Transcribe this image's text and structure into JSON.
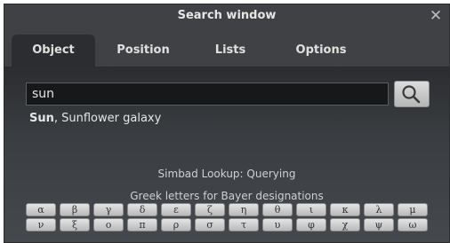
{
  "window": {
    "title": "Search window",
    "close_glyph": "✕"
  },
  "tabs": [
    {
      "label": "Object"
    },
    {
      "label": "Position"
    },
    {
      "label": "Lists"
    },
    {
      "label": "Options"
    }
  ],
  "search": {
    "value": "sun",
    "button_icon": "search-icon"
  },
  "result": {
    "bold": "Sun",
    "rest": ", Sunflower galaxy"
  },
  "status_text": "Simbad Lookup: Querying",
  "greek": {
    "title": "Greek letters for Bayer designations",
    "row1": [
      "α",
      "β",
      "γ",
      "δ",
      "ε",
      "ζ",
      "η",
      "θ",
      "ι",
      "κ",
      "λ",
      "μ"
    ],
    "row2": [
      "ν",
      "ξ",
      "ο",
      "π",
      "ρ",
      "σ",
      "τ",
      "υ",
      "φ",
      "χ",
      "ψ",
      "ω"
    ]
  }
}
